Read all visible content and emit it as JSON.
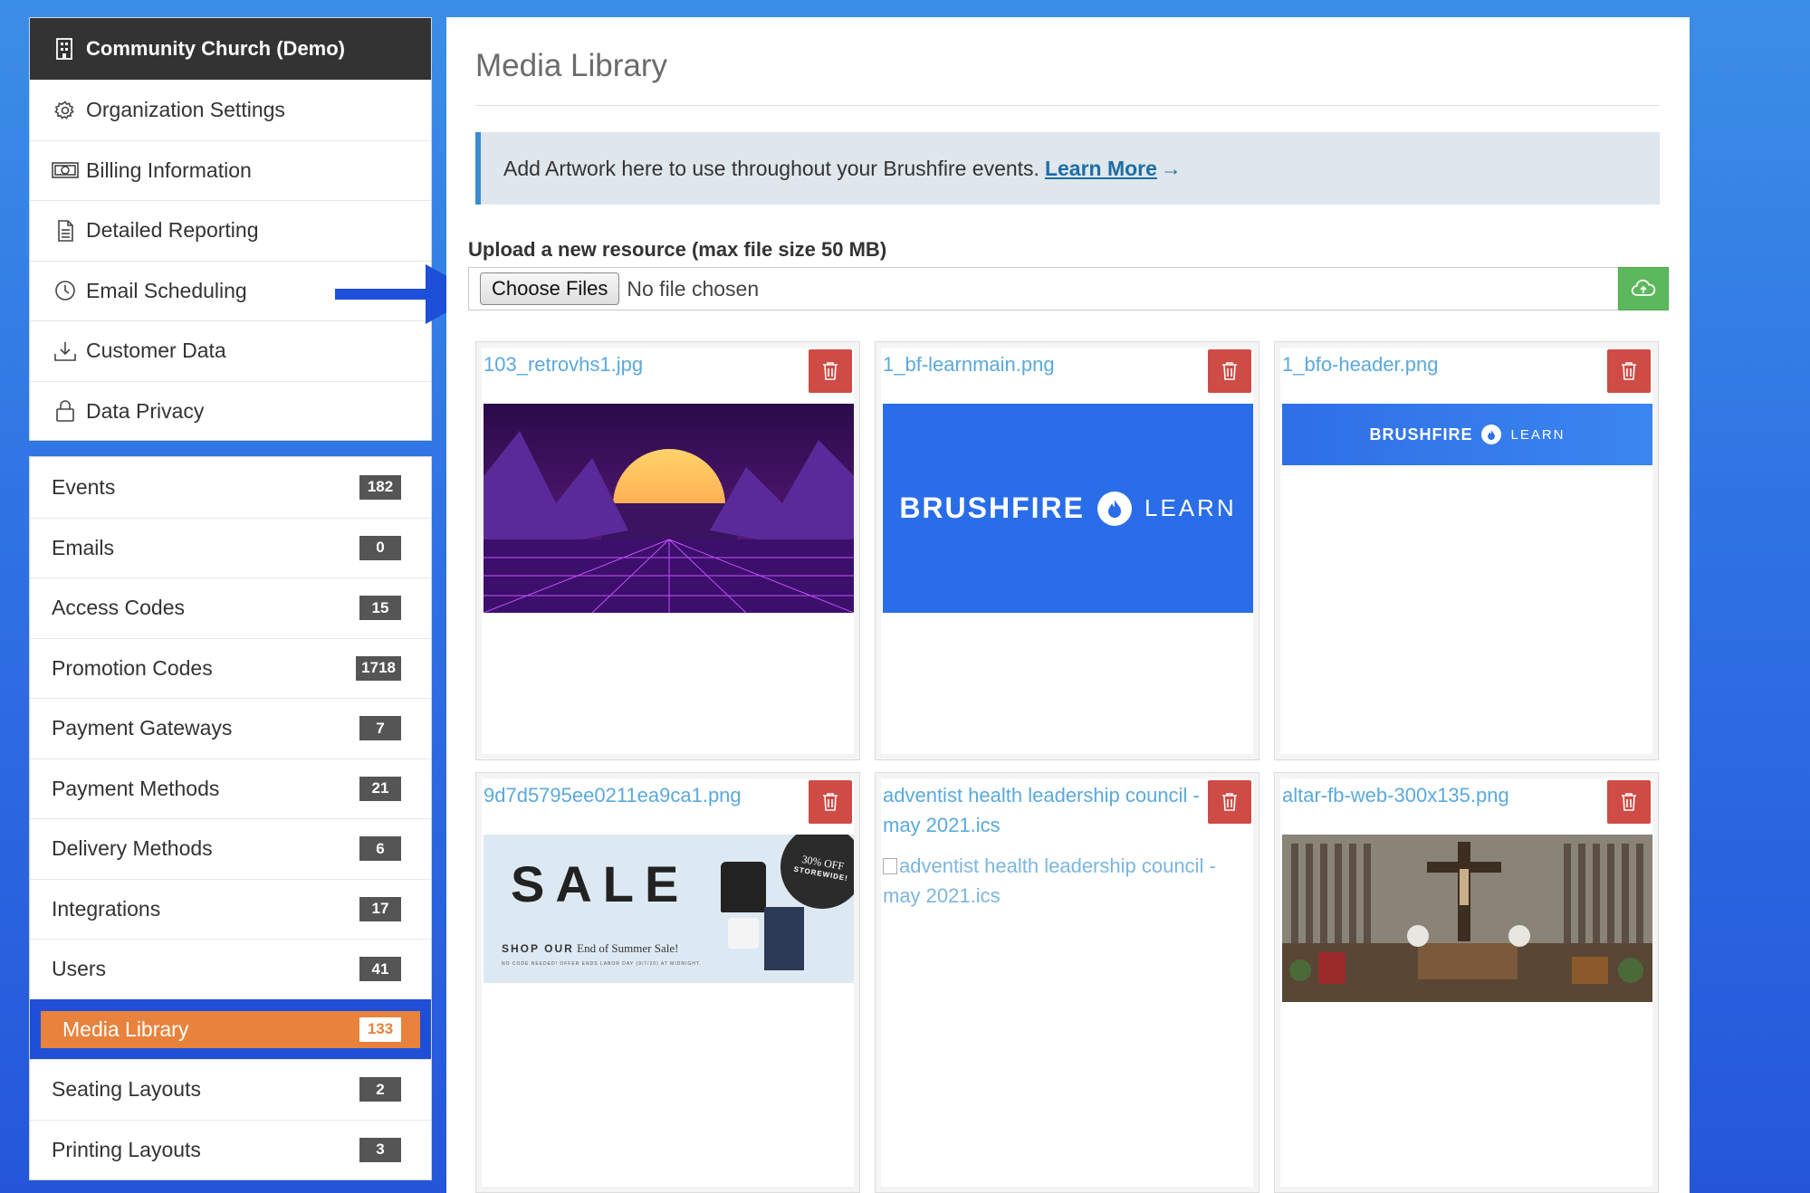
{
  "org": {
    "title": "Community Church (Demo)",
    "items": [
      {
        "label": "Organization Settings",
        "icon": "gear-icon"
      },
      {
        "label": "Billing Information",
        "icon": "money-icon"
      },
      {
        "label": "Detailed Reporting",
        "icon": "document-icon"
      },
      {
        "label": "Email Scheduling",
        "icon": "clock-icon"
      },
      {
        "label": "Customer Data",
        "icon": "download-icon"
      },
      {
        "label": "Data Privacy",
        "icon": "lock-icon"
      }
    ]
  },
  "nav": {
    "items": [
      {
        "label": "Events",
        "count": "182"
      },
      {
        "label": "Emails",
        "count": "0"
      },
      {
        "label": "Access Codes",
        "count": "15"
      },
      {
        "label": "Promotion Codes",
        "count": "1718"
      },
      {
        "label": "Payment Gateways",
        "count": "7"
      },
      {
        "label": "Payment Methods",
        "count": "21"
      },
      {
        "label": "Delivery Methods",
        "count": "6"
      },
      {
        "label": "Integrations",
        "count": "17"
      },
      {
        "label": "Users",
        "count": "41"
      },
      {
        "label": "Media Library",
        "count": "133"
      },
      {
        "label": "Seating Layouts",
        "count": "2"
      },
      {
        "label": "Printing Layouts",
        "count": "3"
      }
    ],
    "active": "Media Library"
  },
  "main": {
    "title": "Media Library",
    "info_text": "Add Artwork here to use throughout your Brushfire events.",
    "info_link": "Learn More",
    "upload_label": "Upload a new resource (max file size 50 MB)",
    "choose_button": "Choose Files",
    "no_file_text": "No file chosen"
  },
  "media": [
    {
      "name": "103_retrovhs1.jpg",
      "thumb": "retro-synthwave-image"
    },
    {
      "name": "1_bf-learnmain.png",
      "thumb": "brushfire-learn-banner",
      "thumb_text": "BRUSHFIRE",
      "thumb_text2": "LEARN"
    },
    {
      "name": "1_bfo-header.png",
      "thumb": "brushfire-header-banner",
      "thumb_text": "BRUSHFIRE",
      "thumb_text2": "LEARN"
    },
    {
      "name": "9d7d5795ee0211ea9ca1.png",
      "thumb": "sale-banner",
      "sale_word": "SALE",
      "sale_sub_bold": "SHOP OUR",
      "sale_sub": "End of Summer Sale!",
      "sale_circle": "30% OFF",
      "sale_circle2": "STOREWIDE!",
      "sale_fine": "NO CODE NEEDED! OFFER ENDS LABOR DAY (9/7/20) AT MIDNIGHT."
    },
    {
      "name": "adventist health leadership council - may 2021.ics",
      "thumb": "broken-image",
      "alt_text": "adventist health leadership council - may 2021.ics"
    },
    {
      "name": "altar-fb-web-300x135.png",
      "thumb": "altar-photo"
    }
  ],
  "colors": {
    "accent_orange": "#e8823c",
    "delete_red": "#cf4b45",
    "upload_green": "#5cb85c",
    "link_blue": "#5aa9dc",
    "highlight_blue": "#1f4fd6"
  }
}
